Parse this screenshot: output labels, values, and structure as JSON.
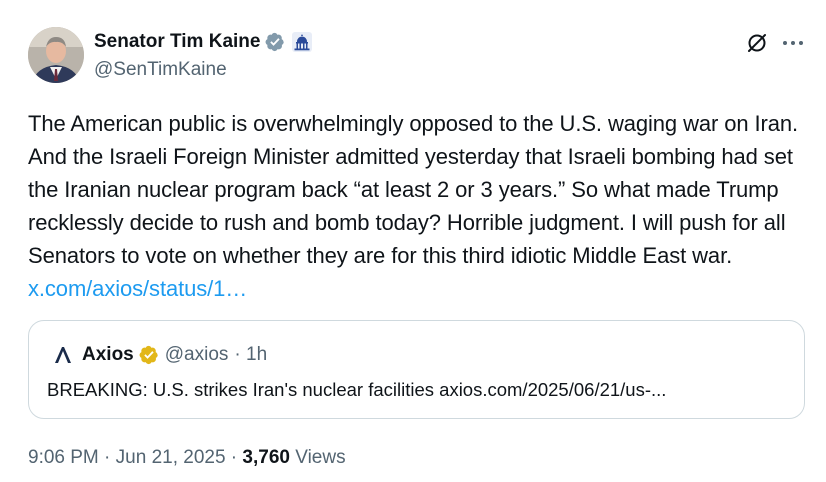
{
  "author": {
    "display_name": "Senator Tim Kaine",
    "handle": "@SenTimKaine",
    "verified_badge_icon": "verified-badge-icon",
    "affiliation_icon": "capitol-icon"
  },
  "tweet": {
    "text": "The American public is overwhelmingly opposed to the U.S. waging war on Iran. And the Israeli Foreign Minister admitted yesterday that Israeli bombing had set the Iranian nuclear program back “at least 2 or 3 years.” So what made Trump recklessly decide to rush and bomb today? Horrible judgment. I will push for all Senators to vote on whether they are for this third idiotic Middle East war. ",
    "link": "x.com/axios/status/1…"
  },
  "quote": {
    "name": "Axios",
    "handle": "@axios",
    "time": "· 1h",
    "text": "BREAKING: U.S. strikes Iran's nuclear facilities axios.com/2025/06/21/us-..."
  },
  "meta": {
    "time": "9:06 PM",
    "separator1": " · ",
    "date": "Jun 21, 2025",
    "separator2": " · ",
    "views_count": "3,760",
    "views_label": " Views"
  },
  "colors": {
    "link": "#1d9bf0",
    "secondary_text": "#536471",
    "verified_blue": "#1d9bf0",
    "verified_gold": "#e2b719"
  }
}
